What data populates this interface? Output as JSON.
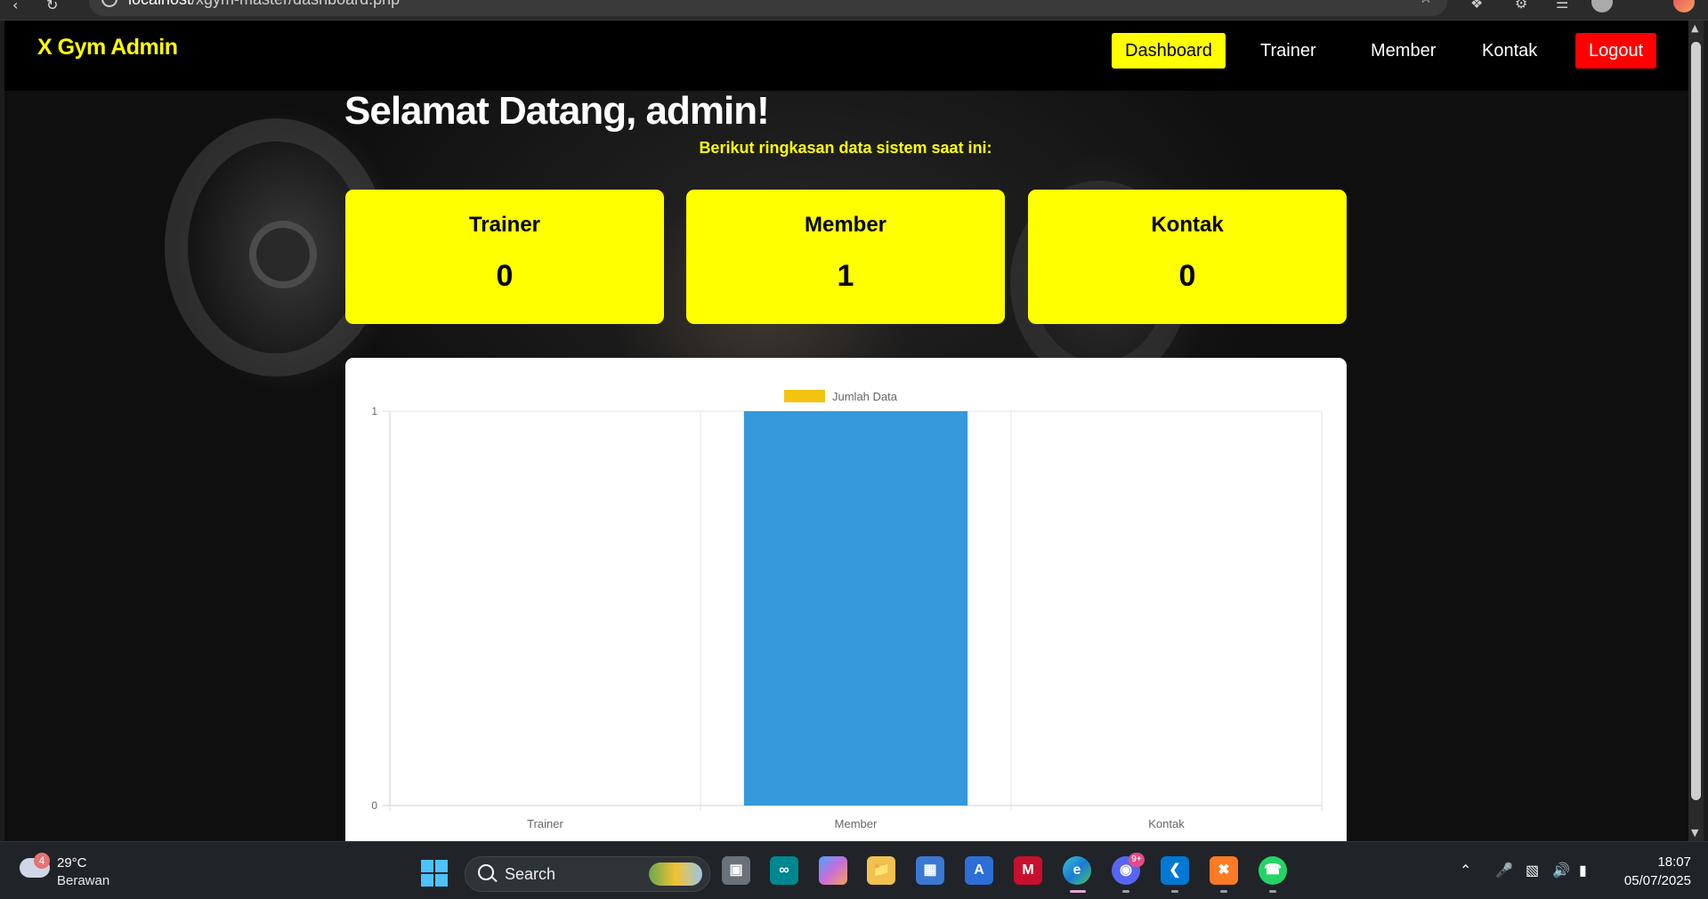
{
  "browser": {
    "url_host": "localhost",
    "url_path": "/xgym-master/dashboard.php"
  },
  "navbar": {
    "brand": "X Gym Admin",
    "links": [
      {
        "label": "Dashboard",
        "active": true
      },
      {
        "label": "Trainer",
        "active": false
      },
      {
        "label": "Member",
        "active": false
      },
      {
        "label": "Kontak",
        "active": false
      }
    ],
    "logout_label": "Logout",
    "colors": {
      "brand": "#ffff00",
      "active_bg": "#ffff00",
      "logout_bg": "#ff0000"
    }
  },
  "main": {
    "welcome": "Selamat Datang, admin!",
    "subtitle": "Berikut ringkasan data sistem saat ini:",
    "cards": [
      {
        "title": "Trainer",
        "value": "0"
      },
      {
        "title": "Member",
        "value": "1"
      },
      {
        "title": "Kontak",
        "value": "0"
      }
    ]
  },
  "chart_data": {
    "type": "bar",
    "categories": [
      "Trainer",
      "Member",
      "Kontak"
    ],
    "series": [
      {
        "name": "Jumlah Data",
        "values": [
          0,
          1,
          0
        ],
        "color": "#3498db",
        "legend_color": "#f1c40f"
      }
    ],
    "yticks": [
      "0",
      "1"
    ],
    "ylim": [
      0,
      1
    ],
    "grid": true,
    "legend_position": "top"
  },
  "taskbar": {
    "weather": {
      "badge": "4",
      "temp": "29°C",
      "desc": "Berawan"
    },
    "search_label": "Search",
    "apps": [
      "task-view",
      "arduino",
      "copilot",
      "file-explorer",
      "microsoft-store",
      "visual-studio-installer",
      "mcafee",
      "edge",
      "discord",
      "vscode",
      "xampp",
      "whatsapp"
    ],
    "discord_badge": "9+",
    "time": "18:07",
    "date": "05/07/2025"
  }
}
